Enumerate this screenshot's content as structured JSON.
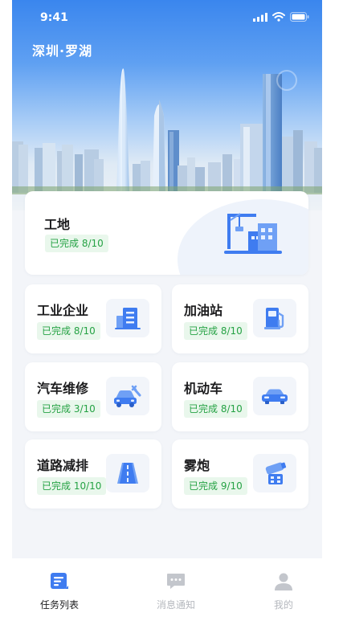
{
  "status_bar": {
    "time": "9:41"
  },
  "header": {
    "city": "深圳·罗湖"
  },
  "tasks": {
    "featured": {
      "label": "工地",
      "status": "已完成 8/10",
      "icon": "construction-site-icon"
    },
    "items": [
      {
        "label": "工业企业",
        "status": "已完成 8/10",
        "icon": "building-icon"
      },
      {
        "label": "加油站",
        "status": "已完成 8/10",
        "icon": "fuel-pump-icon"
      },
      {
        "label": "汽车维修",
        "status": "已完成 3/10",
        "icon": "car-repair-icon"
      },
      {
        "label": "机动车",
        "status": "已完成 8/10",
        "icon": "car-icon"
      },
      {
        "label": "道路减排",
        "status": "已完成 10/10",
        "icon": "road-icon"
      },
      {
        "label": "雾炮",
        "status": "已完成 9/10",
        "icon": "fog-cannon-icon"
      }
    ]
  },
  "tabbar": {
    "tabs": [
      {
        "label": "任务列表",
        "icon": "task-list-icon",
        "active": true
      },
      {
        "label": "消息通知",
        "icon": "message-icon",
        "active": false
      },
      {
        "label": "我的",
        "icon": "user-icon",
        "active": false
      }
    ]
  },
  "colors": {
    "accent": "#3f7cf0",
    "success_text": "#25a244",
    "success_bg": "#e9f7ec",
    "background": "#f3f5f9"
  }
}
